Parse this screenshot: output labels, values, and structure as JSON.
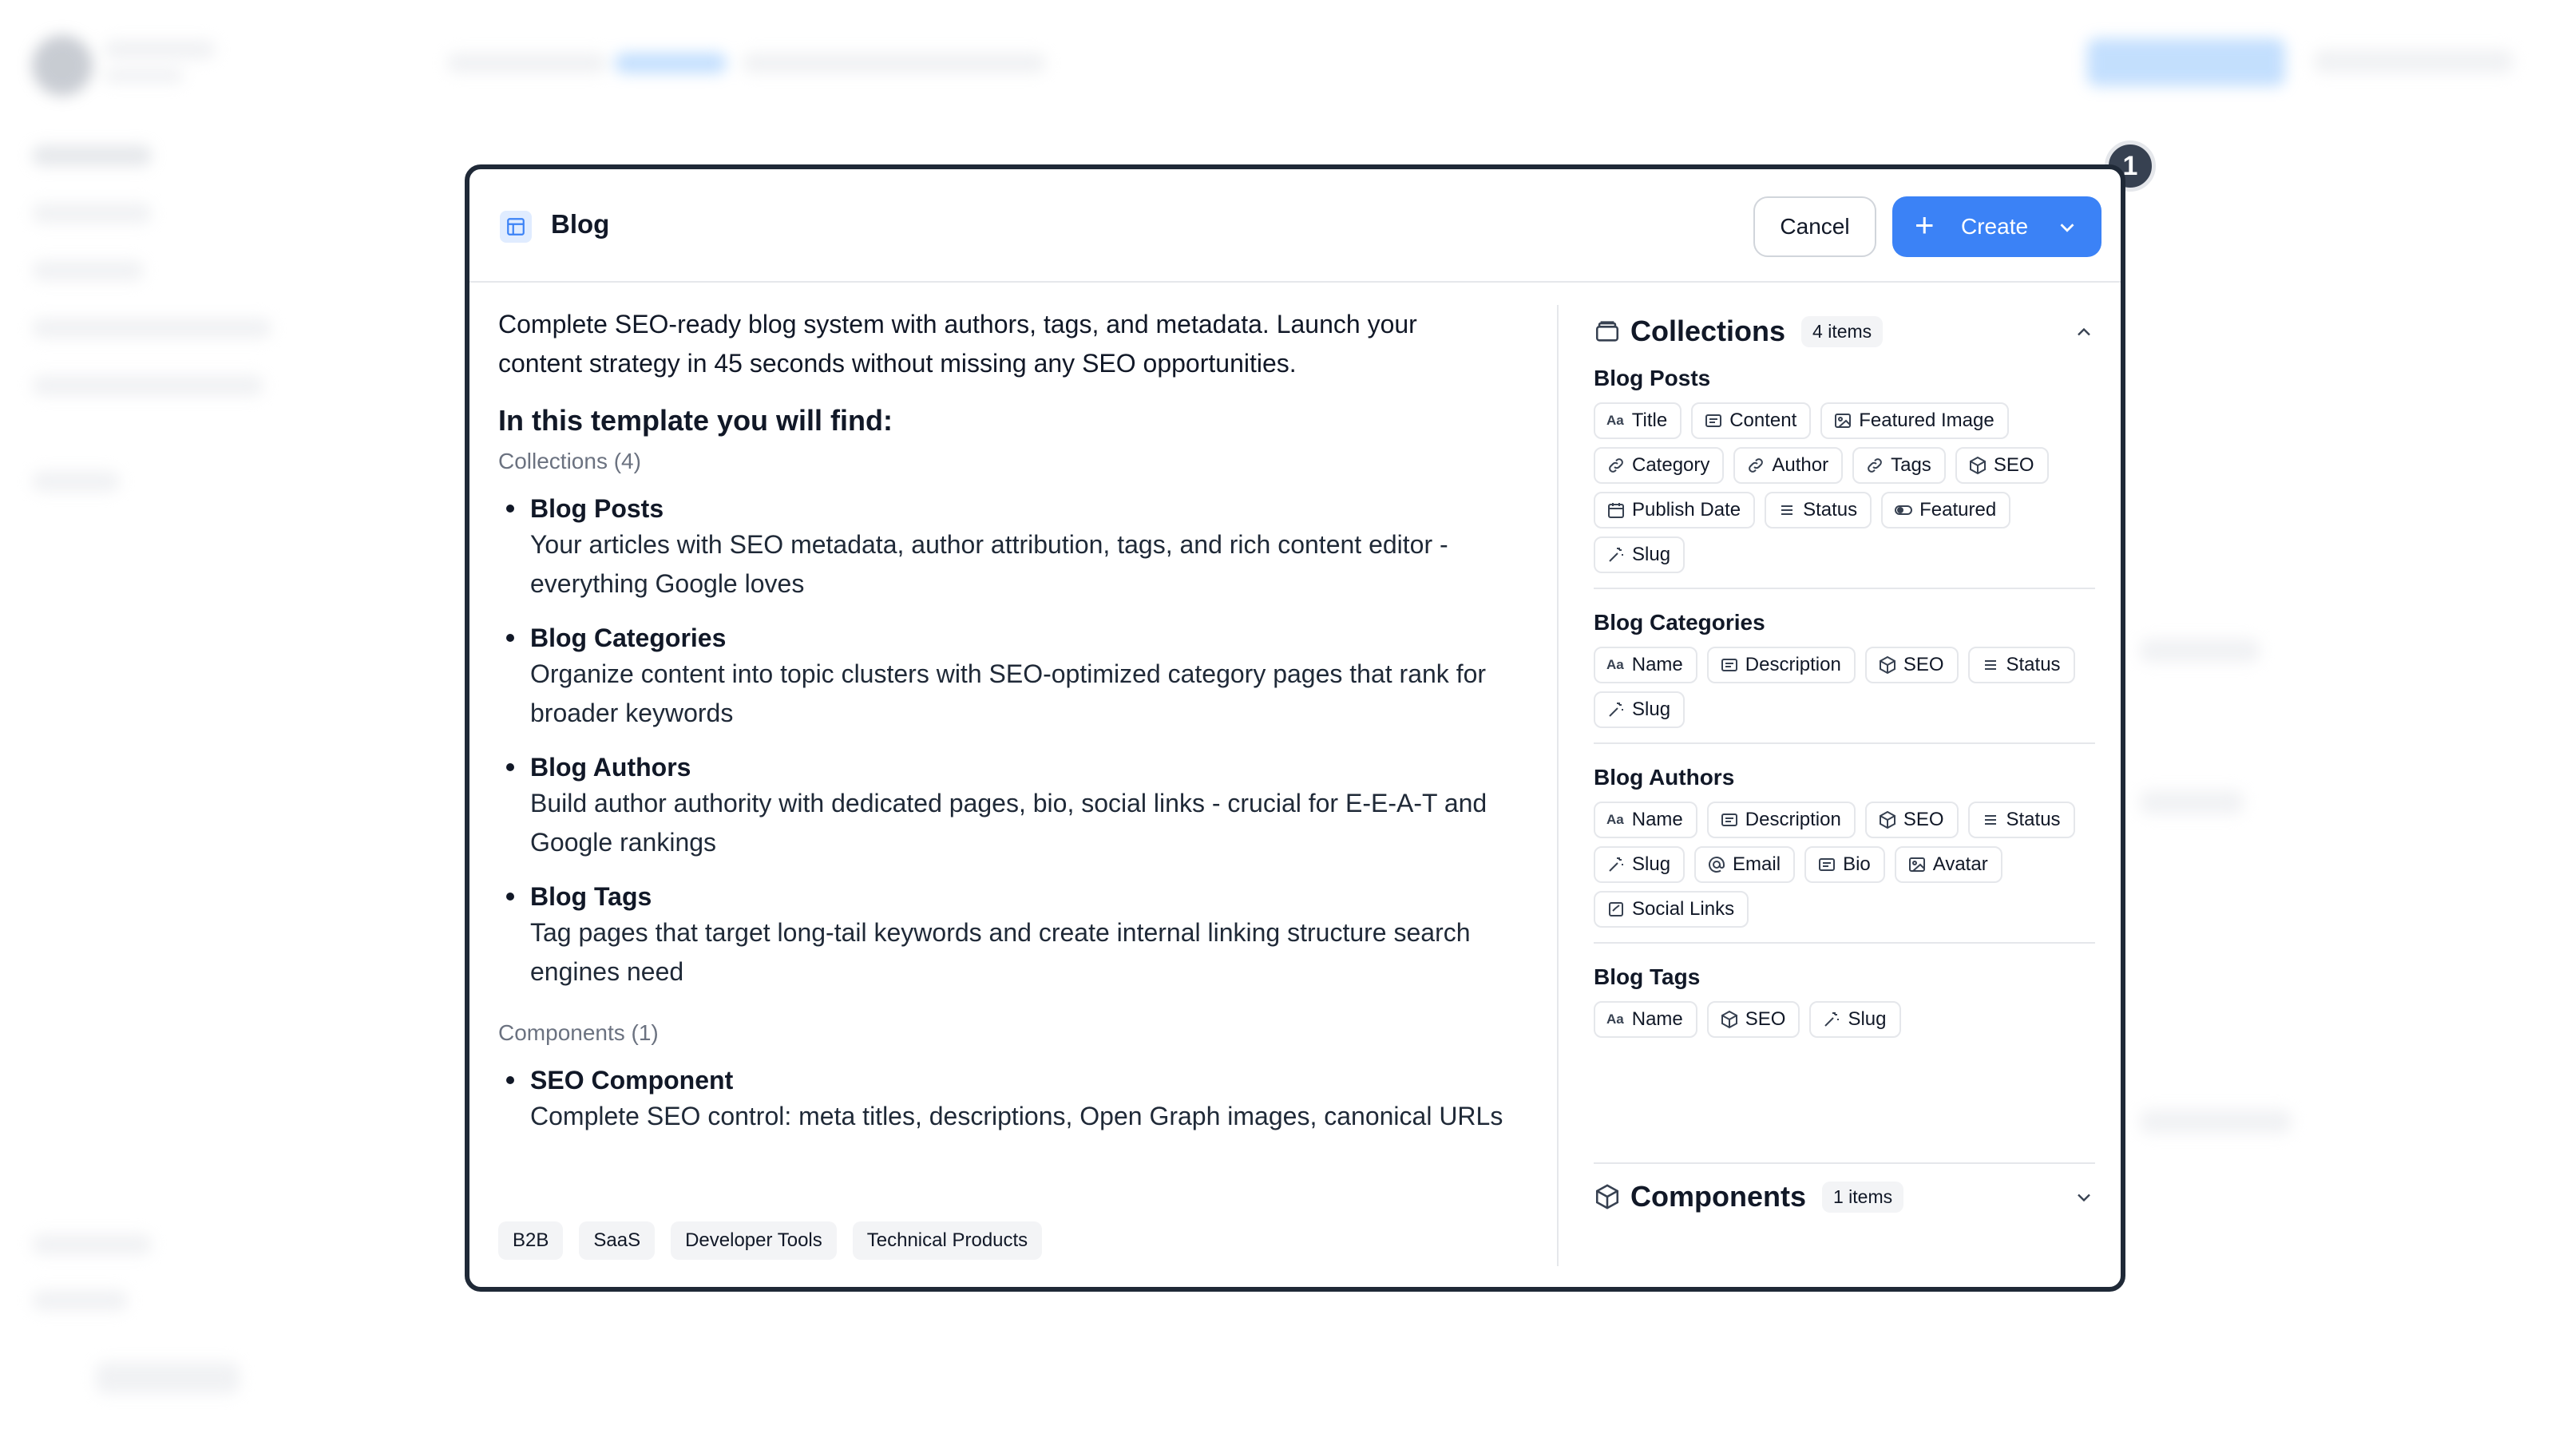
{
  "badge": "1",
  "modal": {
    "title": "Blog",
    "cancel_label": "Cancel",
    "create_label": "Create",
    "intro": "Complete SEO-ready blog system with authors, tags, and metadata. Launch your content strategy in 45 seconds without missing any SEO opportunities.",
    "find_title": "In this template you will find:",
    "collections_label": "Collections (4)",
    "collections": [
      {
        "title": "Blog Posts",
        "desc": "Your articles with SEO metadata, author attribution, tags, and rich content editor - everything Google loves"
      },
      {
        "title": "Blog Categories",
        "desc": "Organize content into topic clusters with SEO-optimized category pages that rank for broader keywords"
      },
      {
        "title": "Blog Authors",
        "desc": "Build author authority with dedicated pages, bio, social links - crucial for E-E-A-T and Google rankings"
      },
      {
        "title": "Blog Tags",
        "desc": "Tag pages that target long-tail keywords and create internal linking structure search engines need"
      }
    ],
    "components_label": "Components (1)",
    "components": [
      {
        "title": "SEO Component",
        "desc": "Complete SEO control: meta titles, descriptions, Open Graph images, canonical URLs"
      }
    ],
    "tags": [
      "B2B",
      "SaaS",
      "Developer Tools",
      "Technical Products"
    ]
  },
  "panel": {
    "collections_title": "Collections",
    "collections_count": "4 items",
    "components_title": "Components",
    "components_count": "1 items",
    "collections": [
      {
        "title": "Blog Posts",
        "fields": [
          {
            "label": "Title",
            "icon": "text"
          },
          {
            "label": "Content",
            "icon": "richtext"
          },
          {
            "label": "Featured Image",
            "icon": "image"
          },
          {
            "label": "Category",
            "icon": "link"
          },
          {
            "label": "Author",
            "icon": "link"
          },
          {
            "label": "Tags",
            "icon": "link"
          },
          {
            "label": "SEO",
            "icon": "cube"
          },
          {
            "label": "Publish Date",
            "icon": "calendar"
          },
          {
            "label": "Status",
            "icon": "list"
          },
          {
            "label": "Featured",
            "icon": "toggle"
          },
          {
            "label": "Slug",
            "icon": "wand"
          }
        ]
      },
      {
        "title": "Blog Categories",
        "fields": [
          {
            "label": "Name",
            "icon": "text"
          },
          {
            "label": "Description",
            "icon": "richtext"
          },
          {
            "label": "SEO",
            "icon": "cube"
          },
          {
            "label": "Status",
            "icon": "list"
          },
          {
            "label": "Slug",
            "icon": "wand"
          }
        ]
      },
      {
        "title": "Blog Authors",
        "fields": [
          {
            "label": "Name",
            "icon": "text"
          },
          {
            "label": "Description",
            "icon": "richtext"
          },
          {
            "label": "SEO",
            "icon": "cube"
          },
          {
            "label": "Status",
            "icon": "list"
          },
          {
            "label": "Slug",
            "icon": "wand"
          },
          {
            "label": "Email",
            "icon": "at"
          },
          {
            "label": "Bio",
            "icon": "richtext"
          },
          {
            "label": "Avatar",
            "icon": "image"
          },
          {
            "label": "Social Links",
            "icon": "checkbox"
          }
        ]
      },
      {
        "title": "Blog Tags",
        "fields": [
          {
            "label": "Name",
            "icon": "text"
          },
          {
            "label": "SEO",
            "icon": "cube"
          },
          {
            "label": "Slug",
            "icon": "wand"
          }
        ]
      }
    ]
  },
  "colors": {
    "accent": "#3b82f6",
    "border": "#1f2937",
    "muted": "#6b7280"
  }
}
